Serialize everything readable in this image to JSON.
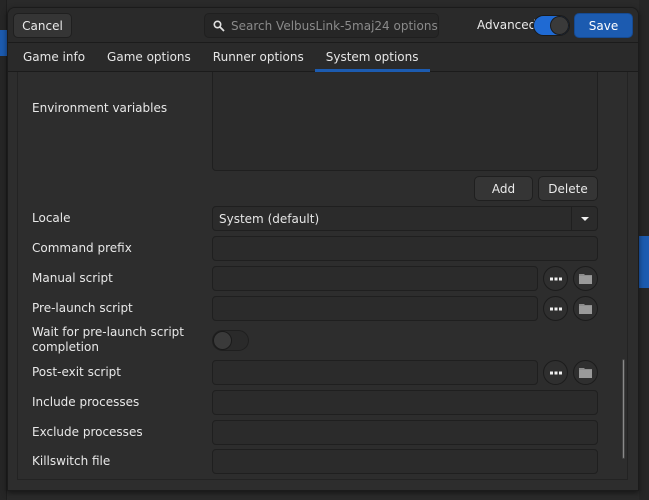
{
  "header": {
    "cancel_label": "Cancel",
    "search_placeholder": "Search VelbusLink-5maj24 options",
    "advanced_label": "Advanced",
    "advanced_enabled": true,
    "save_label": "Save"
  },
  "tabs": [
    {
      "label": "Game info",
      "active": false
    },
    {
      "label": "Game options",
      "active": false
    },
    {
      "label": "Runner options",
      "active": false
    },
    {
      "label": "System options",
      "active": true
    }
  ],
  "options": {
    "environment_variables": {
      "label": "Environment variables",
      "add_label": "Add",
      "delete_label": "Delete"
    },
    "locale": {
      "label": "Locale",
      "value": "System (default)"
    },
    "command_prefix": {
      "label": "Command prefix",
      "value": ""
    },
    "manual_script": {
      "label": "Manual script",
      "value": ""
    },
    "pre_launch_script": {
      "label": "Pre-launch script",
      "value": ""
    },
    "wait_pre_launch": {
      "label": "Wait for pre-launch script completion",
      "enabled": false
    },
    "post_exit_script": {
      "label": "Post-exit script",
      "value": ""
    },
    "include_processes": {
      "label": "Include processes",
      "value": ""
    },
    "exclude_processes": {
      "label": "Exclude processes",
      "value": ""
    },
    "killswitch_file": {
      "label": "Killswitch file",
      "value": ""
    }
  },
  "icons": {
    "search": "search-icon",
    "more": "more-horizontal-icon",
    "folder": "folder-icon",
    "dropdown": "chevron-down-icon"
  },
  "colors": {
    "accent": "#1c5bb0",
    "toggle_on": "#1f6ad3",
    "background": "#2d2d2d"
  }
}
